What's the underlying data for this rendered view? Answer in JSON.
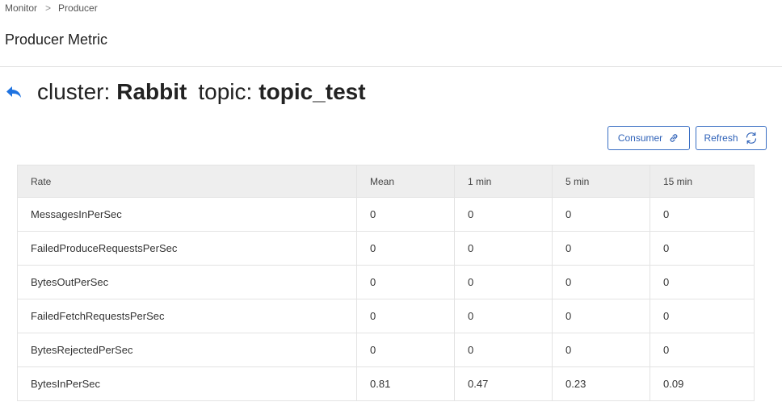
{
  "breadcrumb": {
    "items": [
      "Monitor",
      "Producer"
    ],
    "separator": ">"
  },
  "page_title": "Producer Metric",
  "heading": {
    "cluster_label": "cluster:",
    "cluster_value": "Rabbit",
    "topic_label": "topic:",
    "topic_value": "topic_test",
    "back_icon": "back-arrow-icon"
  },
  "toolbar": {
    "consumer_label": "Consumer",
    "consumer_icon": "link-icon",
    "refresh_label": "Refresh",
    "refresh_icon": "refresh-icon"
  },
  "colors": {
    "accent": "#2f62b8",
    "back_icon": "#1f73e0",
    "header_bg": "#eeeeee"
  },
  "table": {
    "columns": [
      "Rate",
      "Mean",
      "1 min",
      "5 min",
      "15 min"
    ],
    "rows": [
      [
        "MessagesInPerSec",
        "0",
        "0",
        "0",
        "0"
      ],
      [
        "FailedProduceRequestsPerSec",
        "0",
        "0",
        "0",
        "0"
      ],
      [
        "BytesOutPerSec",
        "0",
        "0",
        "0",
        "0"
      ],
      [
        "FailedFetchRequestsPerSec",
        "0",
        "0",
        "0",
        "0"
      ],
      [
        "BytesRejectedPerSec",
        "0",
        "0",
        "0",
        "0"
      ],
      [
        "BytesInPerSec",
        "0.81",
        "0.47",
        "0.23",
        "0.09"
      ]
    ]
  }
}
